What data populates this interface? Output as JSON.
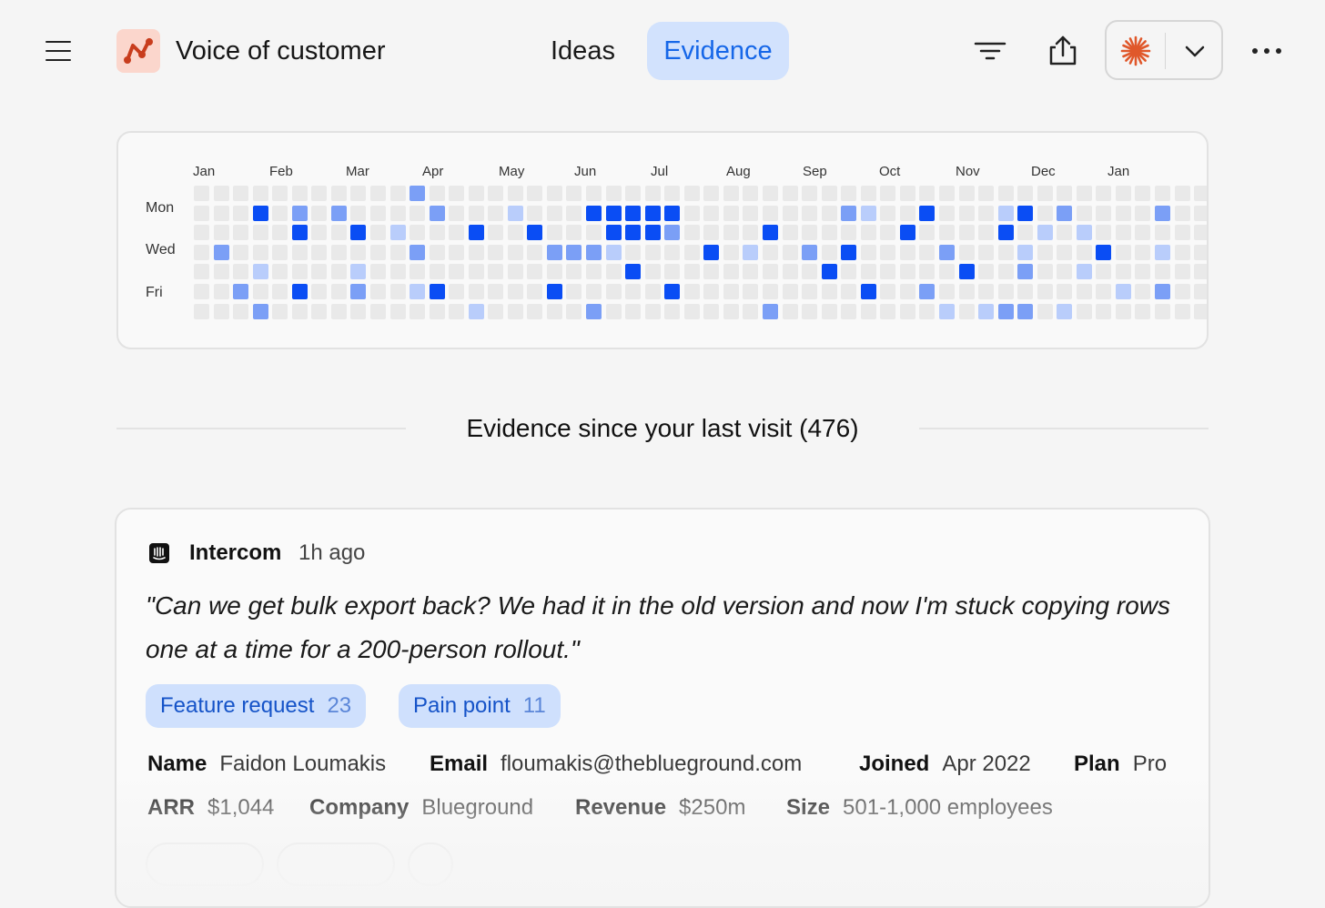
{
  "header": {
    "app_title": "Voice of customer",
    "tabs": [
      {
        "label": "Ideas",
        "active": false
      },
      {
        "label": "Evidence",
        "active": true
      }
    ],
    "icons": [
      "menu-icon",
      "filter-icon",
      "share-icon",
      "sparkle-icon",
      "chevron-down-icon",
      "more-icon"
    ],
    "accent_color": "#1667e8",
    "brand_color": "#e0582b"
  },
  "heatmap": {
    "months": [
      "Jan",
      "Feb",
      "Mar",
      "Apr",
      "May",
      "Jun",
      "Jul",
      "Aug",
      "Sep",
      "Oct",
      "Nov",
      "Dec",
      "Jan"
    ],
    "days": [
      "Mon",
      "Wed",
      "Fri"
    ],
    "colors": [
      "#e9e9e9",
      "#b9cdfb",
      "#7b9ff6",
      "#0a4df4"
    ],
    "levels": [
      [
        0,
        0,
        0,
        0,
        0,
        0,
        0,
        0,
        0,
        0,
        0,
        2,
        0,
        0,
        0,
        0,
        0,
        0,
        0,
        0,
        0,
        0,
        0,
        0,
        0,
        0,
        0,
        0,
        0,
        0,
        0,
        0,
        0,
        0,
        0,
        0,
        0,
        0,
        0,
        0,
        0,
        0,
        0,
        0,
        0,
        0,
        0,
        0,
        0,
        0,
        0,
        0,
        0,
        0
      ],
      [
        0,
        0,
        0,
        3,
        0,
        2,
        0,
        2,
        0,
        0,
        0,
        0,
        2,
        0,
        0,
        0,
        1,
        0,
        0,
        0,
        3,
        3,
        3,
        3,
        3,
        0,
        0,
        0,
        0,
        0,
        0,
        0,
        0,
        2,
        1,
        0,
        0,
        3,
        0,
        0,
        0,
        1,
        3,
        0,
        2,
        0,
        0,
        0,
        0,
        2,
        0,
        0,
        0,
        0
      ],
      [
        0,
        0,
        0,
        0,
        0,
        3,
        0,
        0,
        3,
        0,
        1,
        0,
        0,
        0,
        3,
        0,
        0,
        3,
        0,
        0,
        0,
        3,
        3,
        3,
        2,
        0,
        0,
        0,
        0,
        3,
        0,
        0,
        0,
        0,
        0,
        0,
        3,
        0,
        0,
        0,
        0,
        3,
        0,
        1,
        0,
        1,
        0,
        0,
        0,
        0,
        0,
        0,
        0,
        0
      ],
      [
        0,
        2,
        0,
        0,
        0,
        0,
        0,
        0,
        0,
        0,
        0,
        2,
        0,
        0,
        0,
        0,
        0,
        0,
        2,
        2,
        2,
        1,
        0,
        0,
        0,
        0,
        3,
        0,
        1,
        0,
        0,
        2,
        0,
        3,
        0,
        0,
        0,
        0,
        2,
        0,
        0,
        0,
        1,
        0,
        0,
        0,
        3,
        0,
        0,
        1,
        0,
        0,
        0,
        0
      ],
      [
        0,
        0,
        0,
        1,
        0,
        0,
        0,
        0,
        1,
        0,
        0,
        0,
        0,
        0,
        0,
        0,
        0,
        0,
        0,
        0,
        0,
        0,
        3,
        0,
        0,
        0,
        0,
        0,
        0,
        0,
        0,
        0,
        3,
        0,
        0,
        0,
        0,
        0,
        0,
        3,
        0,
        0,
        2,
        0,
        0,
        1,
        0,
        0,
        0,
        0,
        0,
        0,
        0,
        0
      ],
      [
        0,
        0,
        2,
        0,
        0,
        3,
        0,
        0,
        2,
        0,
        0,
        1,
        3,
        0,
        0,
        0,
        0,
        0,
        3,
        0,
        0,
        0,
        0,
        0,
        3,
        0,
        0,
        0,
        0,
        0,
        0,
        0,
        0,
        0,
        3,
        0,
        0,
        2,
        0,
        0,
        0,
        0,
        0,
        0,
        0,
        0,
        0,
        1,
        0,
        2,
        0,
        0,
        0,
        0
      ],
      [
        0,
        0,
        0,
        2,
        0,
        0,
        0,
        0,
        0,
        0,
        0,
        0,
        0,
        0,
        1,
        0,
        0,
        0,
        0,
        0,
        2,
        0,
        0,
        0,
        0,
        0,
        0,
        0,
        0,
        2,
        0,
        0,
        0,
        0,
        0,
        0,
        0,
        0,
        1,
        0,
        1,
        2,
        2,
        0,
        1,
        0,
        0,
        0,
        0,
        0,
        0,
        0,
        0,
        0
      ]
    ]
  },
  "section": {
    "title": "Evidence since your last visit (476)"
  },
  "evidence": {
    "source": "Intercom",
    "time": "1h ago",
    "quote": "\"Can we get bulk export back? We had it in the old version and now I'm stuck copying rows one at a time for a 200-person rollout.\"",
    "tags": [
      {
        "label": "Feature request",
        "count": "23"
      },
      {
        "label": "Pain point",
        "count": "11"
      }
    ],
    "fields": {
      "name": {
        "label": "Name",
        "value": "Faidon Loumakis"
      },
      "email": {
        "label": "Email",
        "value": "floumakis@theblueground.com"
      },
      "joined": {
        "label": "Joined",
        "value": "Apr 2022"
      },
      "plan": {
        "label": "Plan",
        "value": "Pro"
      },
      "arr": {
        "label": "ARR",
        "value": "$1,044"
      },
      "company": {
        "label": "Company",
        "value": "Blueground"
      },
      "revenue": {
        "label": "Revenue",
        "value": "$250m"
      },
      "size": {
        "label": "Size",
        "value": "501-1,000 employees"
      }
    }
  }
}
